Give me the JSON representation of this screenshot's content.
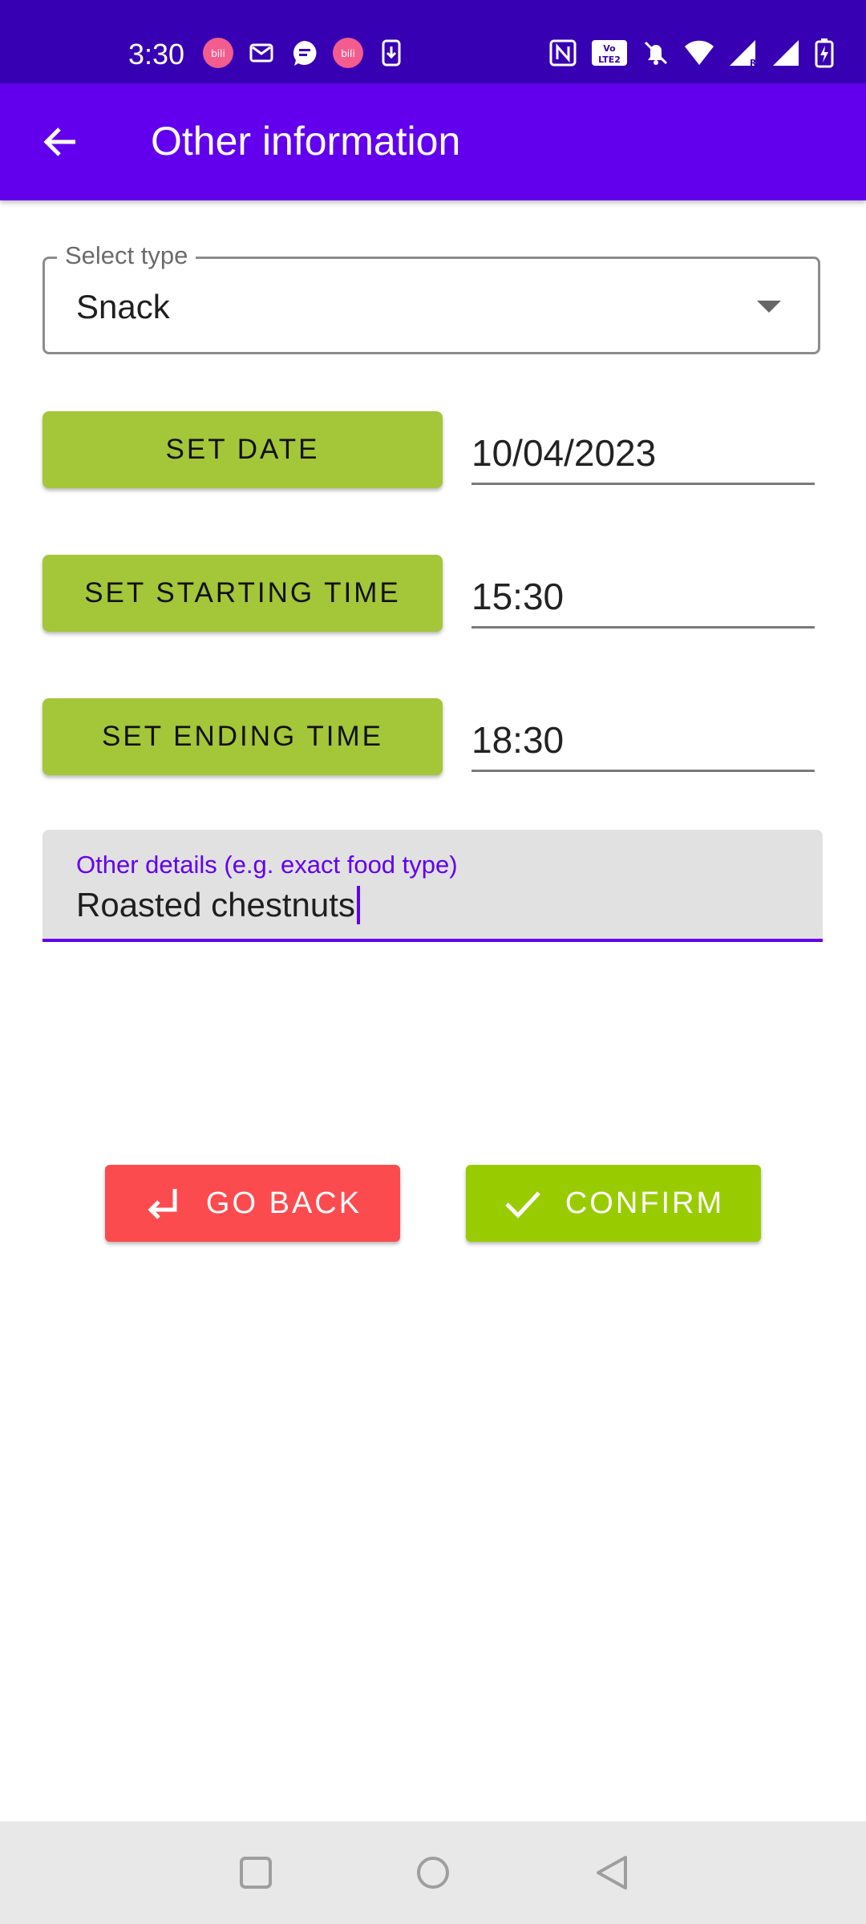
{
  "status_bar": {
    "time": "3:30",
    "notification_icons": [
      "bilibili-icon",
      "mail-icon",
      "chat-icon",
      "bilibili-icon",
      "download-icon"
    ],
    "system_icons": [
      "nfc-icon",
      "volte-icon",
      "bell-off-icon",
      "wifi-icon",
      "signal-roaming-icon",
      "signal-icon",
      "battery-charging-icon"
    ]
  },
  "app_bar": {
    "title": "Other information",
    "back_icon": "arrow-back-icon"
  },
  "form": {
    "type_select": {
      "label": "Select type",
      "value": "Snack"
    },
    "date": {
      "button_label": "SET DATE",
      "value": "10/04/2023"
    },
    "start_time": {
      "button_label": "SET STARTING TIME",
      "value": "15:30"
    },
    "end_time": {
      "button_label": "SET ENDING TIME",
      "value": "18:30"
    },
    "details": {
      "label": "Other details (e.g. exact food type)",
      "value": "Roasted chestnuts"
    }
  },
  "actions": {
    "go_back_label": "GO BACK",
    "confirm_label": "CONFIRM"
  },
  "colors": {
    "status_bar": "#3700b3",
    "app_bar": "#6200ee",
    "action_green": "#a4c639",
    "confirm_green": "#99cc00",
    "go_back_red": "#fb4b4e"
  }
}
